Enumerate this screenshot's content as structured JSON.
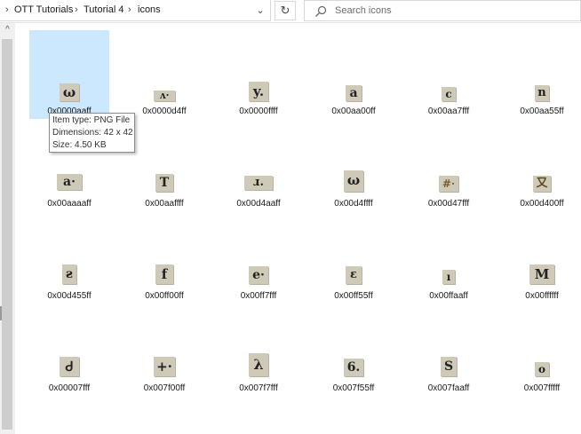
{
  "breadcrumb": {
    "items": [
      "OTT Tutorials",
      "Tutorial 4",
      "icons"
    ]
  },
  "search": {
    "placeholder": "Search icons"
  },
  "icons": {
    "row1": [
      {
        "label": "0x0000aaff",
        "glyph": "ω"
      },
      {
        "label": "0x0000d4ff",
        "glyph": "ʌ·"
      },
      {
        "label": "0x0000ffff",
        "glyph": "y."
      },
      {
        "label": "0x00aa00ff",
        "glyph": "a"
      },
      {
        "label": "0x00aa7fff",
        "glyph": "c"
      },
      {
        "label": "0x00aa55ff",
        "glyph": "n"
      }
    ],
    "row2": [
      {
        "label": "0x00aaaaff",
        "glyph": "a·"
      },
      {
        "label": "0x00aaffff",
        "glyph": "T"
      },
      {
        "label": "0x00d4aaff",
        "glyph": "ɹ."
      },
      {
        "label": "0x00d4ffff",
        "glyph": "ω"
      },
      {
        "label": "0x00d47fff",
        "glyph": "#·"
      },
      {
        "label": "0x00d400ff",
        "glyph": "又"
      }
    ],
    "row3": [
      {
        "label": "0x00d455ff",
        "glyph": "ƨ"
      },
      {
        "label": "0x00ff00ff",
        "glyph": "f"
      },
      {
        "label": "0x00ff7fff",
        "glyph": "e·"
      },
      {
        "label": "0x00ff55ff",
        "glyph": "ɛ"
      },
      {
        "label": "0x00ffaaff",
        "glyph": "ı"
      },
      {
        "label": "0x00ffffff",
        "glyph": "M"
      }
    ],
    "row4": [
      {
        "label": "0x00007fff",
        "glyph": "Ꮷ"
      },
      {
        "label": "0x007f00ff",
        "glyph": "+·"
      },
      {
        "label": "0x007f7fff",
        "glyph": "λ"
      },
      {
        "label": "0x007f55ff",
        "glyph": "6."
      },
      {
        "label": "0x007faaff",
        "glyph": "S"
      },
      {
        "label": "0x007fffff",
        "glyph": "o"
      }
    ]
  },
  "tooltip": {
    "type": "Item type: PNG File",
    "dimensions": "Dimensions: 42 x 42",
    "size": "Size: 4.50 KB"
  },
  "glyphs": {
    "chevron": "›",
    "dropdown": "⌄",
    "refresh": "↻",
    "scroll_up": "^"
  }
}
